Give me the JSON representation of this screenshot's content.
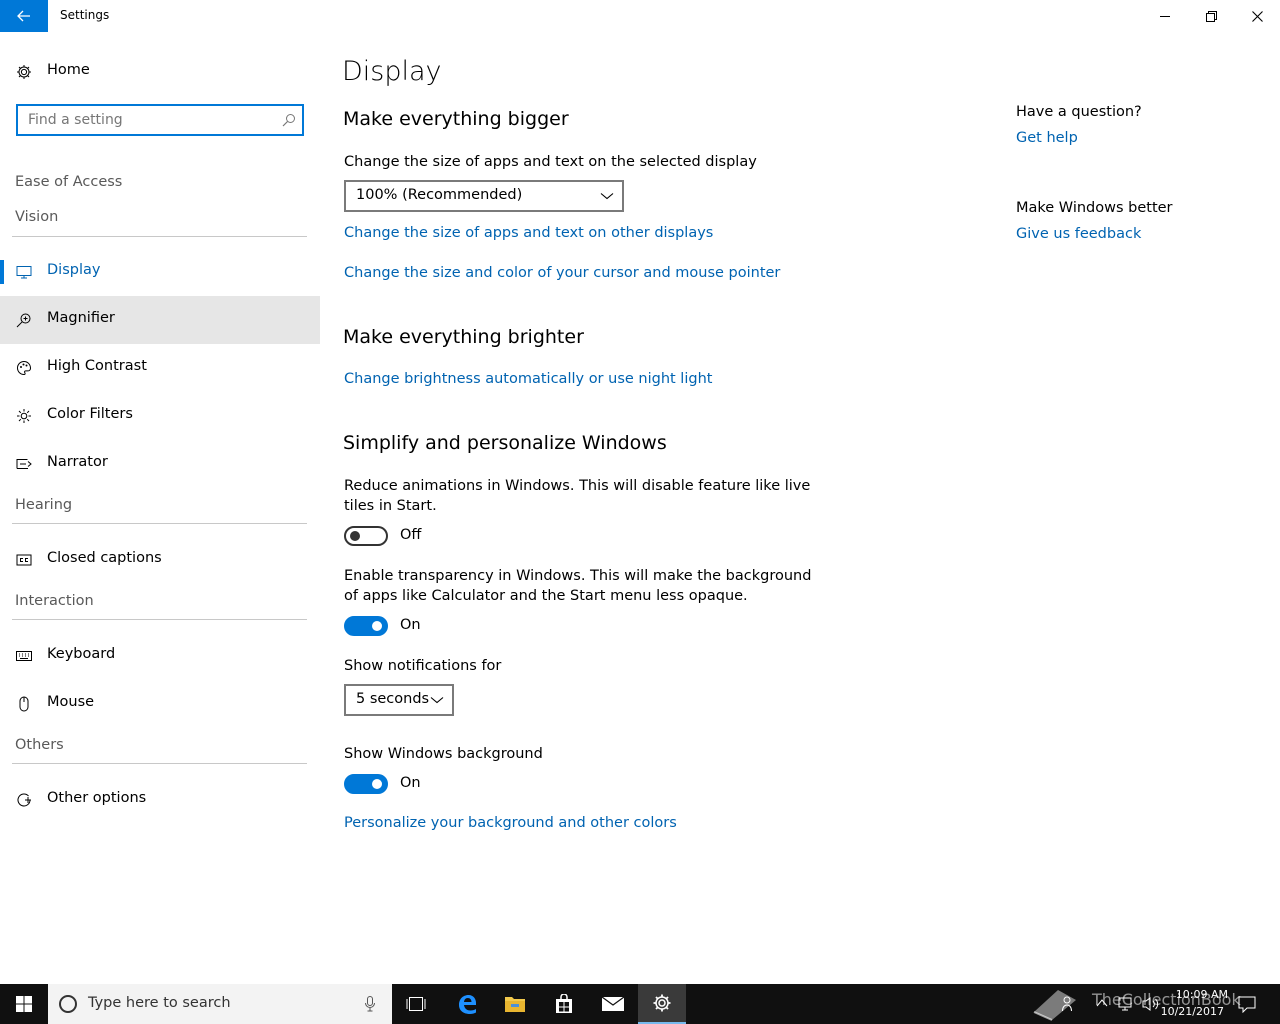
{
  "window": {
    "title": "Settings"
  },
  "sidebar": {
    "home_label": "Home",
    "search_placeholder": "Find a setting",
    "breadcrumb": "Ease of Access",
    "groups": {
      "vision": "Vision",
      "hearing": "Hearing",
      "interaction": "Interaction",
      "others": "Others"
    },
    "items": [
      {
        "label": "Display",
        "icon": "monitor-icon",
        "selected": true
      },
      {
        "label": "Magnifier",
        "icon": "magnifier-icon",
        "hover": true
      },
      {
        "label": "High Contrast",
        "icon": "palette-icon"
      },
      {
        "label": "Color Filters",
        "icon": "sun-icon"
      },
      {
        "label": "Narrator",
        "icon": "narrator-icon"
      },
      {
        "label": "Closed captions",
        "icon": "cc-icon"
      },
      {
        "label": "Keyboard",
        "icon": "keyboard-icon"
      },
      {
        "label": "Mouse",
        "icon": "mouse-icon"
      },
      {
        "label": "Other options",
        "icon": "other-options-icon"
      }
    ]
  },
  "main": {
    "page_title": "Display",
    "bigger": {
      "heading": "Make everything bigger",
      "scale_label": "Change the size of apps and text on the selected display",
      "scale_value": "100% (Recommended)",
      "link_other_displays": "Change the size of apps and text on other displays",
      "link_cursor": "Change the size and color of your cursor and mouse pointer"
    },
    "brighter": {
      "heading": "Make everything brighter",
      "link_brightness": "Change brightness automatically or use night light"
    },
    "simplify": {
      "heading": "Simplify and personalize Windows",
      "animations_label_1": "Reduce animations in Windows.  This will disable feature like live",
      "animations_label_2": "tiles in Start.",
      "animations_state": "Off",
      "transparency_label_1": "Enable transparency in Windows.  This will make the background",
      "transparency_label_2": "of apps like Calculator and the Start menu less opaque.",
      "transparency_state": "On",
      "notifications_label": "Show notifications for",
      "notifications_value": "5 seconds",
      "background_label": "Show Windows background",
      "background_state": "On",
      "link_personalize": "Personalize your background and other colors"
    }
  },
  "aside": {
    "question_heading": "Have a question?",
    "get_help": "Get help",
    "better_heading": "Make Windows better",
    "feedback": "Give us feedback"
  },
  "taskbar": {
    "search_placeholder": "Type here to search",
    "time": "10:09 AM",
    "date": "10/21/2017",
    "watermark": "TheCollectionBook"
  },
  "colors": {
    "accent": "#0078d7",
    "link": "#0063b1",
    "taskbar": "#101010"
  }
}
